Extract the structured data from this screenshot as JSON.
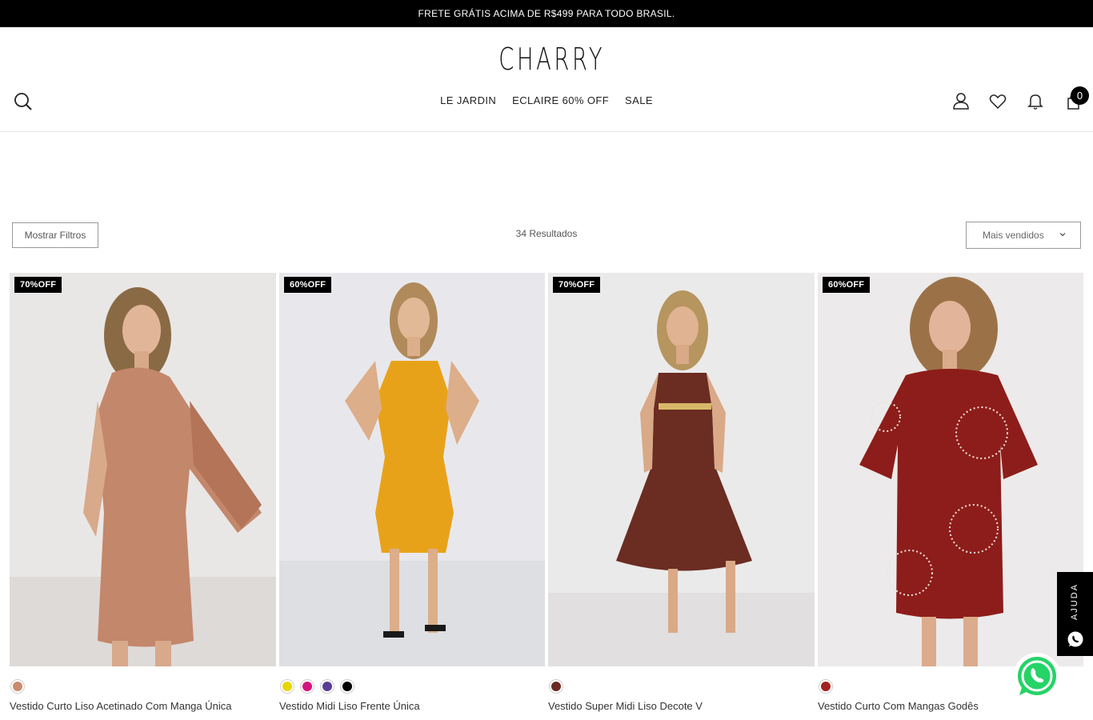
{
  "announcement": "FRETE GRÁTIS ACIMA DE R$499 PARA TODO BRASIL.",
  "brand": "CHARRY",
  "nav": [
    "LE JARDIN",
    "ECLAIRE 60% OFF",
    "SALE"
  ],
  "header_icons": [
    "search-icon",
    "user-icon",
    "heart-icon",
    "bell-icon",
    "bag-icon"
  ],
  "cart_count": "0",
  "toolbar": {
    "filters_label": "Mostrar Filtros",
    "results_label": "34 Resultados",
    "sort_label": "Mais vendidos"
  },
  "products": [
    {
      "name": "Vestido Curto Liso Acetinado Com Manga Única",
      "discount": "70%OFF",
      "swatches": [
        "#cc8a6c"
      ]
    },
    {
      "name": "Vestido Midi Liso Frente Única",
      "discount": "60%OFF",
      "swatches": [
        "#e6d600",
        "#d4137e",
        "#5a3d95",
        "#000000"
      ]
    },
    {
      "name": "Vestido Super Midi Liso Decote V",
      "discount": "70%OFF",
      "swatches": [
        "#6a2a22"
      ]
    },
    {
      "name": "Vestido Curto Com Mangas Godês",
      "discount": "60%OFF",
      "swatches": [
        "#a3211e"
      ]
    }
  ],
  "help": {
    "label": "AJUDA"
  },
  "colors": {
    "topbar": "#000000",
    "whatsapp": "#25d366"
  }
}
